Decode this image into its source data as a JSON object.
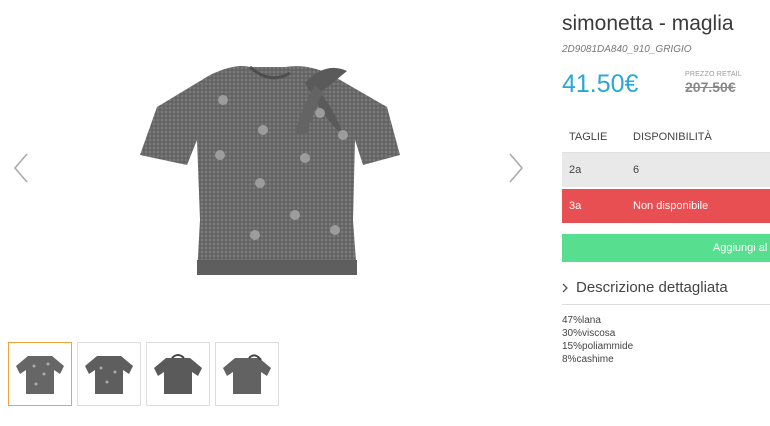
{
  "product": {
    "title": "simonetta - maglia",
    "sku": "2D9081DA840_910_GRIGIO",
    "price": "41.50€",
    "retail_label": "PREZZO RETAIL",
    "retail_price": "207.50€"
  },
  "sizes": {
    "headers": [
      "TAGLIE",
      "DISPONIBILITÀ"
    ],
    "rows": [
      {
        "size": "2a",
        "availability": "6"
      },
      {
        "size": "3a",
        "availability": "Non disponibile"
      }
    ]
  },
  "cart_button": "Aggiungi al ca",
  "description": {
    "toggle": "Descrizione dettagliata",
    "composition": [
      "47%lana",
      "30%viscosa",
      "15%poliammide",
      "8%cashime"
    ]
  },
  "icons": {
    "prev": "chevron-left-icon",
    "next": "chevron-right-icon",
    "expand": "chevron-right-icon"
  },
  "colors": {
    "price": "#2aa7d8",
    "unavailable": "#e84f53",
    "cart": "#58de8f",
    "active_thumb": "#f0a53b"
  },
  "thumbnails": {
    "count": 4,
    "active_index": 0
  }
}
